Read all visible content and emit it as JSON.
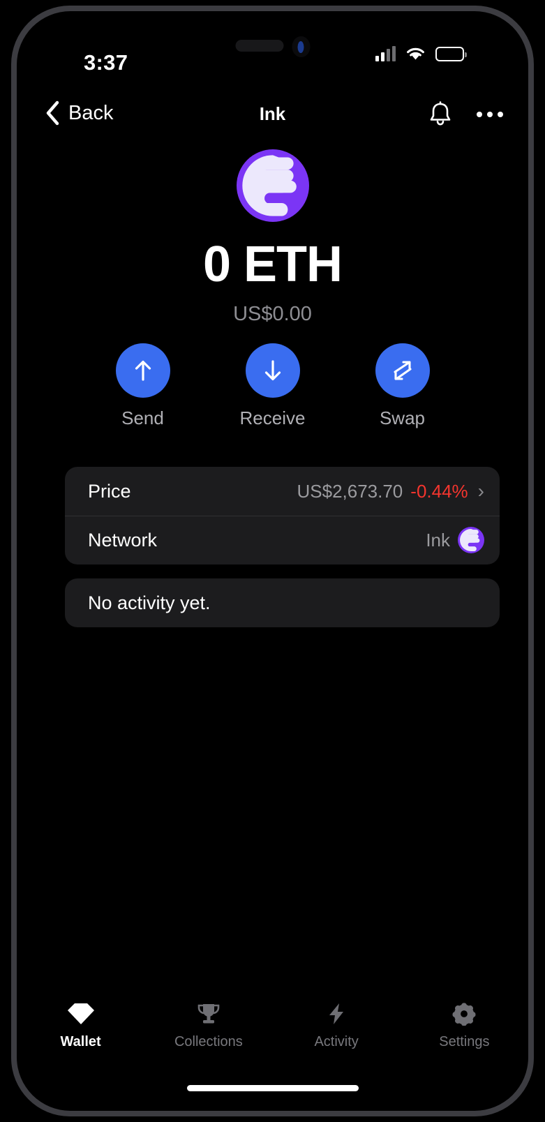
{
  "status_bar": {
    "time": "3:37",
    "signal_icon": "cellular-signal-icon",
    "wifi_icon": "wifi-icon",
    "battery_icon": "battery-icon"
  },
  "nav_bar": {
    "back_label": "Back",
    "back_icon": "chevron-left-icon",
    "title": "Ink",
    "notifications_icon": "bell-icon",
    "more_icon": "more-options-icon"
  },
  "token": {
    "logo_icon": "ink-token-logo",
    "balance": "0 ETH",
    "fiat_balance": "US$0.00"
  },
  "actions": [
    {
      "label": "Send",
      "icon": "arrow-up-icon"
    },
    {
      "label": "Receive",
      "icon": "arrow-down-icon"
    },
    {
      "label": "Swap",
      "icon": "swap-arrows-icon"
    }
  ],
  "info_rows": {
    "price": {
      "label": "Price",
      "value": "US$2,673.70",
      "delta": "-0.44%",
      "chevron": "›"
    },
    "network": {
      "label": "Network",
      "value": "Ink",
      "logo_icon": "ink-network-logo"
    }
  },
  "activity": {
    "empty_text": "No activity yet."
  },
  "tabs": [
    {
      "label": "Wallet",
      "icon": "gem-icon",
      "active": true
    },
    {
      "label": "Collections",
      "icon": "trophy-icon",
      "active": false
    },
    {
      "label": "Activity",
      "icon": "lightning-bolt-icon",
      "active": false
    },
    {
      "label": "Settings",
      "icon": "gear-icon",
      "active": false
    }
  ],
  "colors": {
    "accent_blue": "#3a6df0",
    "ink_purple": "#7b35f5",
    "negative_red": "#f4352e",
    "card_bg": "#1c1c1e",
    "muted_text": "#8e8e93"
  }
}
